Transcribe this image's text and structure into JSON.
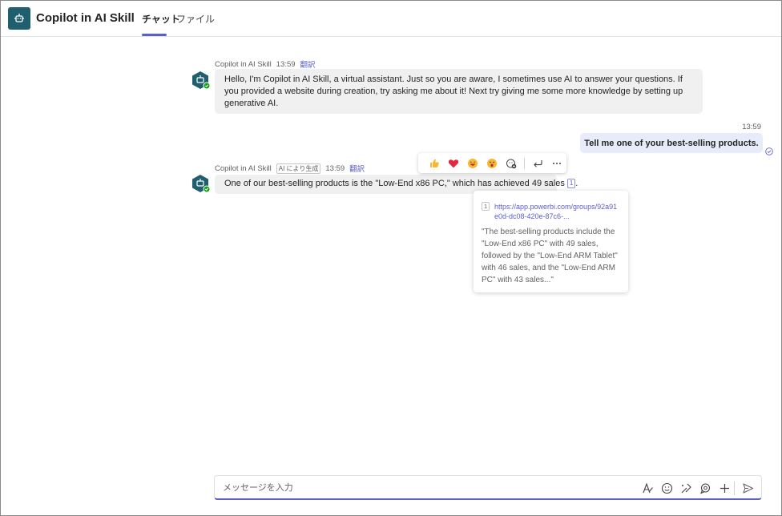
{
  "app": {
    "title": "Copilot in AI Skill",
    "brand_color": "#1f5f6e",
    "accent": "#5b5fc7"
  },
  "tabs": [
    {
      "label": "チャット",
      "active": true
    },
    {
      "label": "ファイル",
      "active": false
    }
  ],
  "messages": [
    {
      "sender": "Copilot in AI Skill",
      "time": "13:59",
      "translate": "翻訳",
      "text": "Hello, I'm Copilot in AI Skill, a virtual assistant. Just so you are aware, I sometimes use AI to answer your questions. If you provided a website during creation, try asking me about it! Next try giving me some more knowledge by setting up generative AI."
    },
    {
      "time": "13:59",
      "text": "Tell me one of your best-selling products."
    },
    {
      "sender": "Copilot in AI Skill",
      "ai_badge": "AI により生成",
      "time": "13:59",
      "translate": "翻訳",
      "text": "One of our best-selling products is the \"Low-End x86 PC,\" which has achieved 49 sales",
      "citation_number": "1",
      "trailing": "."
    }
  ],
  "reactions": [
    "like-icon",
    "heart-icon",
    "laugh-icon",
    "surprised-icon",
    "add-reaction-icon",
    "reply-icon",
    "more-icon"
  ],
  "citation": {
    "number": "1",
    "url": "https://app.powerbi.com/groups/92a91e0d-dc08-420e-87c6-...",
    "quote": "\"The best-selling products include the \"Low-End x86 PC\" with 49 sales, followed by the \"Low-End ARM Tablet\" with 46 sales, and the \"Low-End ARM PC\" with 43 sales...\""
  },
  "compose": {
    "placeholder": "メッセージを入力",
    "tools": [
      "format-icon",
      "emoji-icon",
      "sticker-icon",
      "loop-icon",
      "add-icon",
      "send-icon"
    ]
  }
}
